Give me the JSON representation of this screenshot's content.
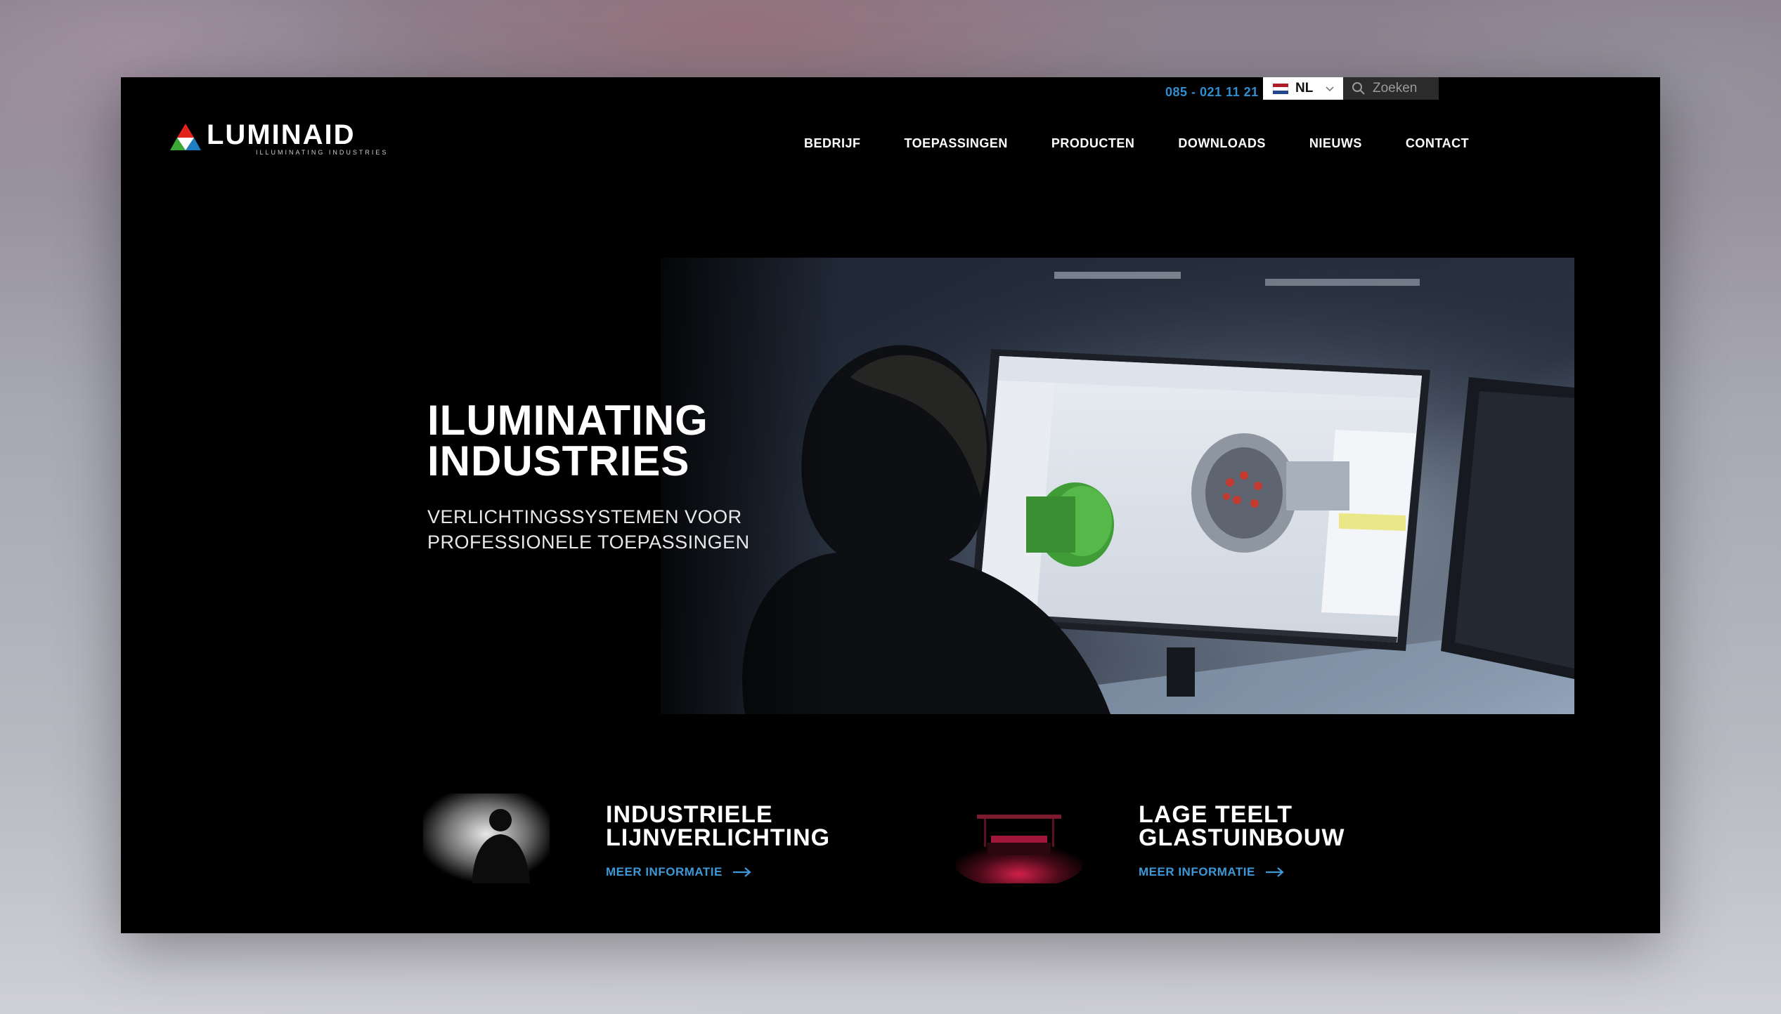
{
  "topbar": {
    "phone": "085 - 021 11 21",
    "language": "NL",
    "search_placeholder": "Zoeken"
  },
  "logo": {
    "name": "LUMINAID",
    "tagline": "ILLUMINATING INDUSTRIES"
  },
  "nav": {
    "items": [
      "BEDRIJF",
      "TOEPASSINGEN",
      "PRODUCTEN",
      "DOWNLOADS",
      "NIEUWS",
      "CONTACT"
    ]
  },
  "hero": {
    "title_line1": "ILUMINATING",
    "title_line2": "INDUSTRIES",
    "subtitle_line1": "VERLICHTINGSSYSTEMEN VOOR",
    "subtitle_line2": "PROFESSIONELE TOEPASSINGEN"
  },
  "cards": [
    {
      "title_line1": "INDUSTRIELE",
      "title_line2": "LIJNVERLICHTING",
      "link": "MEER INFORMATIE"
    },
    {
      "title_line1": "LAGE TEELT",
      "title_line2": "GLASTUINBOUW",
      "link": "MEER INFORMATIE"
    }
  ],
  "colors": {
    "accent_blue": "#3d98d8",
    "background": "#000000",
    "flag_red": "#ae1c28",
    "flag_white": "#ffffff",
    "flag_blue": "#21468b"
  }
}
